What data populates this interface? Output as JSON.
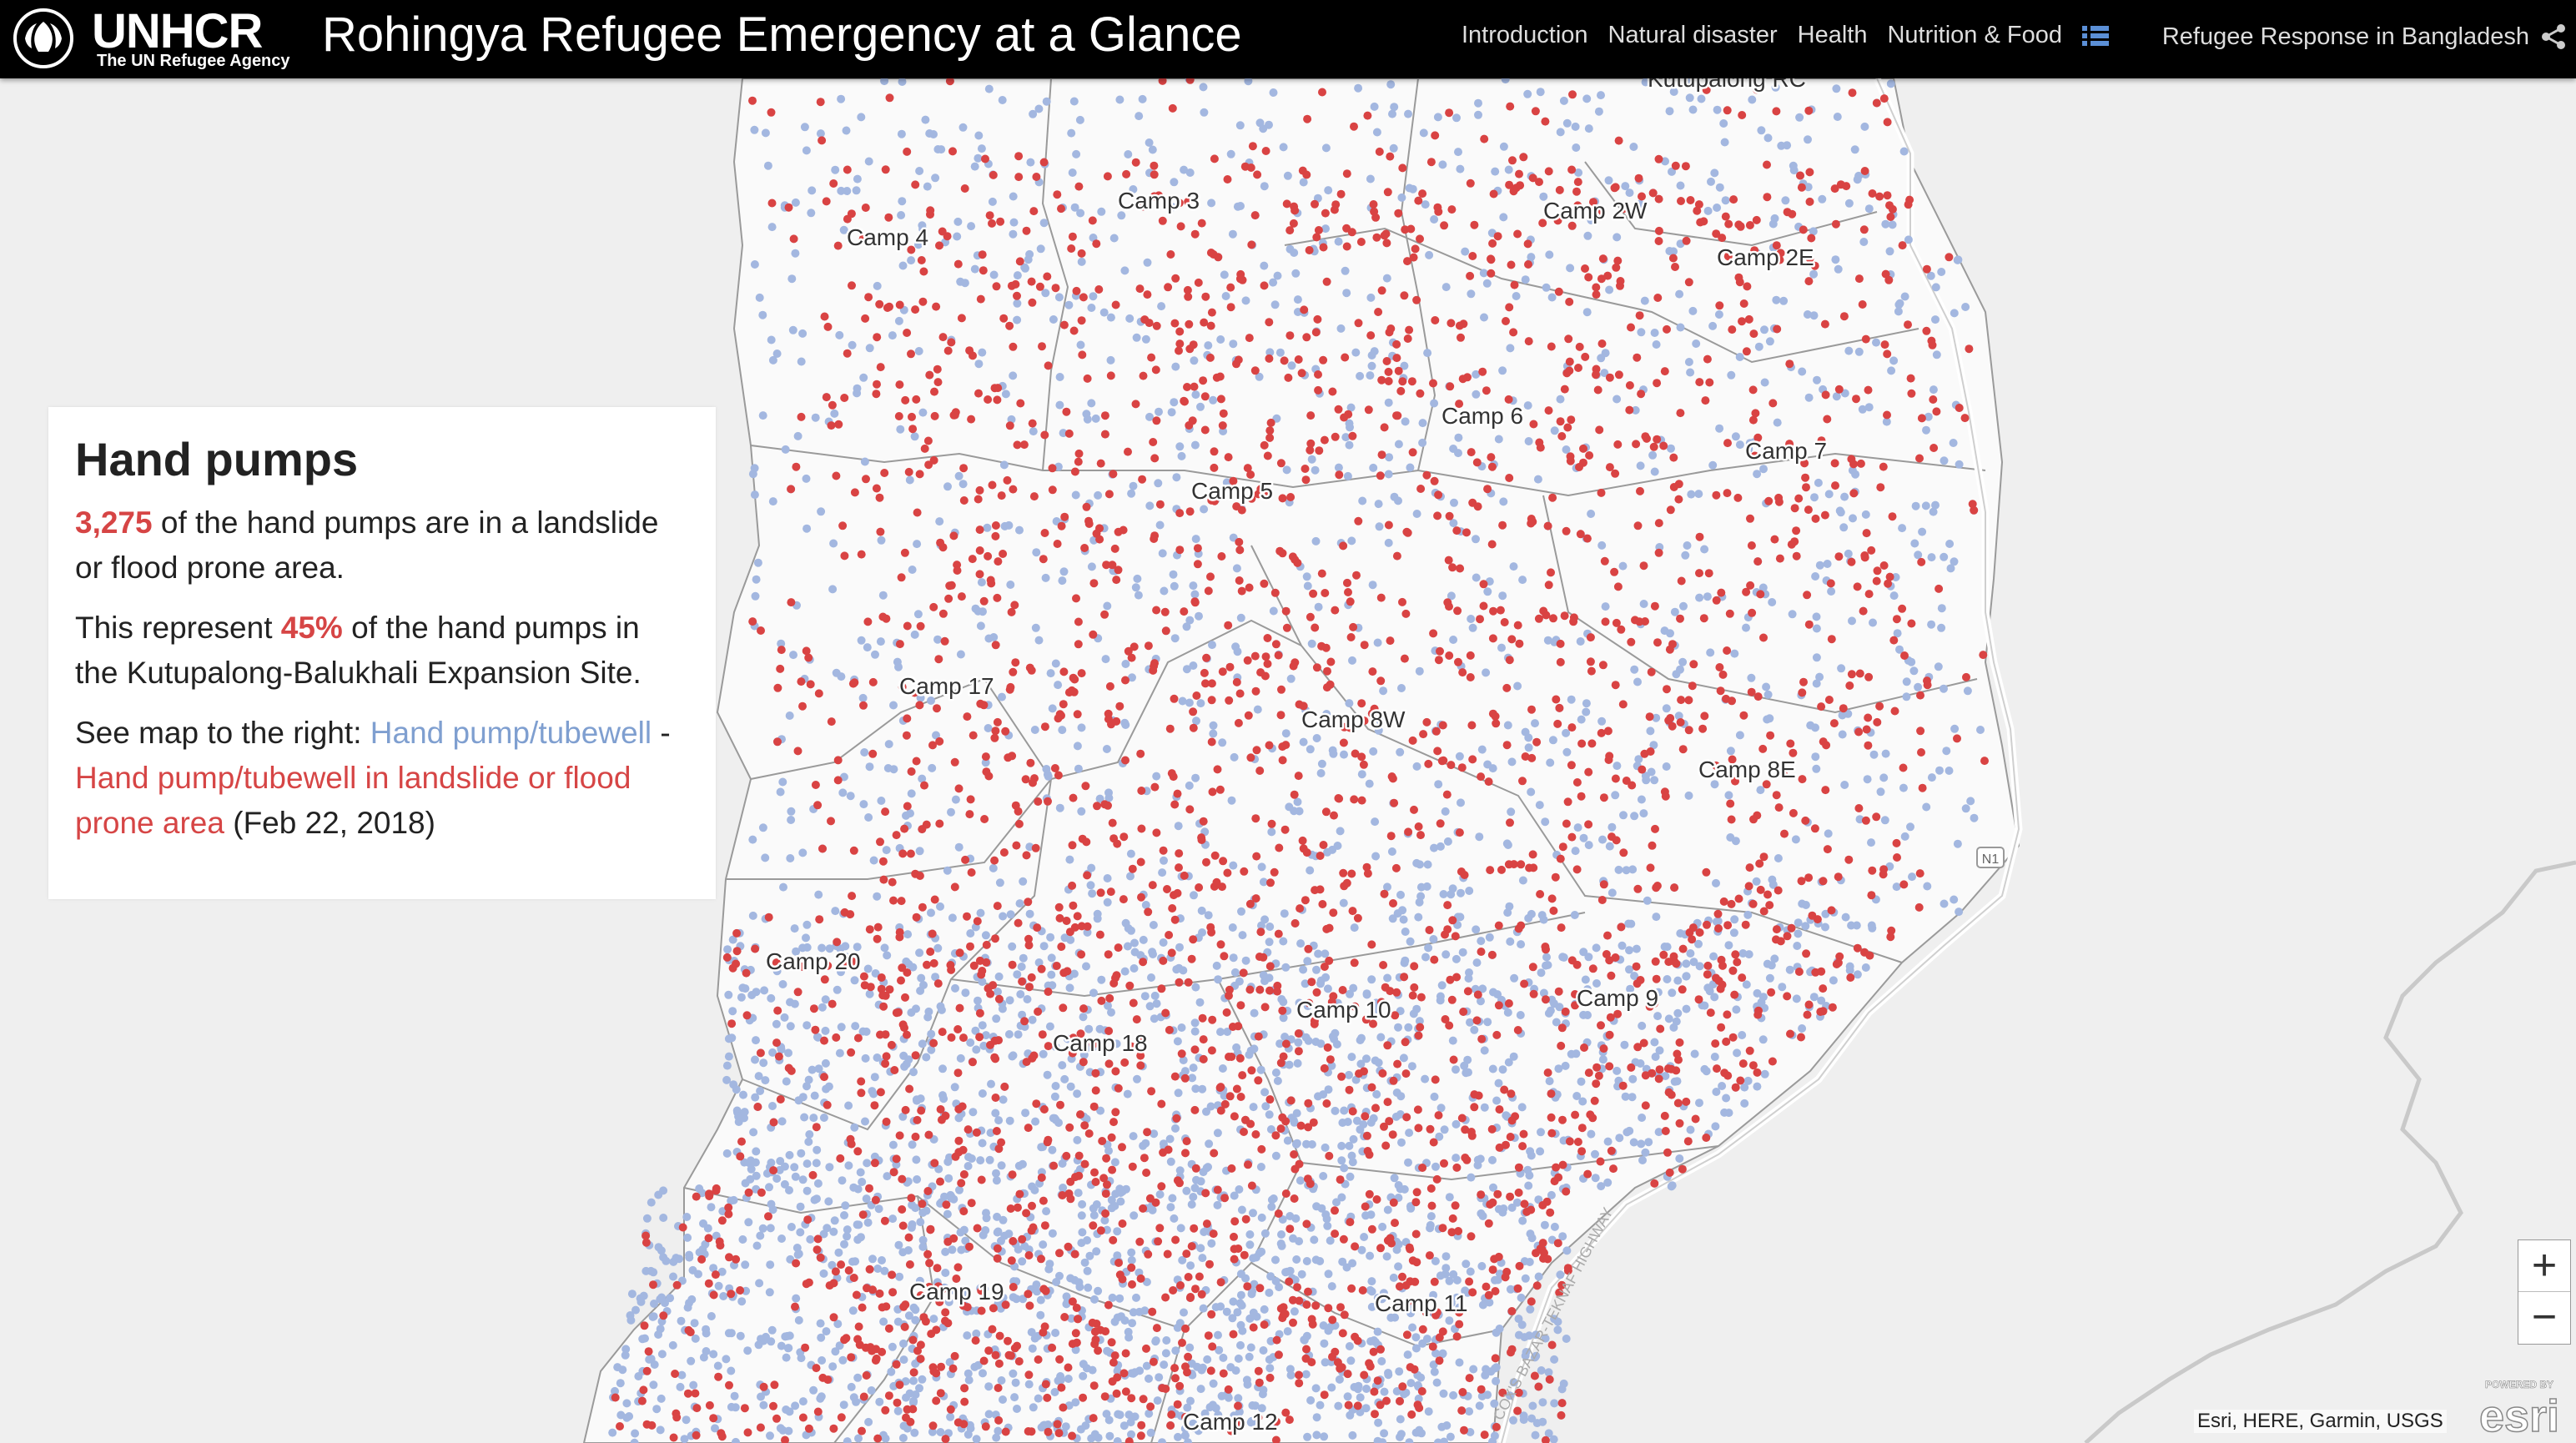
{
  "header": {
    "logo_name": "UNHCR",
    "logo_subtitle": "The UN Refugee Agency",
    "title": "Rohingya Refugee Emergency at a Glance",
    "nav": [
      "Introduction",
      "Natural disaster",
      "Health",
      "Nutrition & Food"
    ],
    "nav_icon": "list-icon",
    "external_link": "Refugee Response in Bangladesh",
    "share_icon": "share-icon",
    "background_color": "#000000"
  },
  "panel": {
    "title": "Hand pumps",
    "p1_value": "3,275",
    "p1_text": " of the hand pumps are in a landslide or flood prone area.",
    "p2_prefix": "This represent ",
    "p2_value": "45%",
    "p2_suffix": " of the hand pumps in the Kutupalong-Balukhali Expansion Site.",
    "p3_prefix": "See map to the right: ",
    "legend_normal": "Hand pump/tubewell",
    "p3_separator": " - ",
    "legend_risk": "Hand pump/tubewell in landslide or flood prone area",
    "p3_suffix": " (Feb 22, 2018)"
  },
  "legend_colors": {
    "normal": "#a3b7e0",
    "risk": "#d94343"
  },
  "map": {
    "camp_labels": [
      "Kutupalong RC",
      "Camp 3",
      "Camp 4",
      "Camp 2W",
      "Camp 2E",
      "Camp 6",
      "Camp 7",
      "Camp 5",
      "Camp 17",
      "Camp 8W",
      "Camp 8E",
      "Camp 20",
      "Camp 10",
      "Camp 9",
      "Camp 18",
      "Camp 19",
      "Camp 11",
      "Camp 12"
    ],
    "road_label": "N1",
    "highway_label": "COX'S BAZAR-TEKNAF HIGHWAY"
  },
  "controls": {
    "zoom_in": "+",
    "zoom_out": "−"
  },
  "attribution": "Esri, HERE, Garmin, USGS",
  "esri_logo": {
    "powered_by": "POWERED BY",
    "name": "esri"
  }
}
